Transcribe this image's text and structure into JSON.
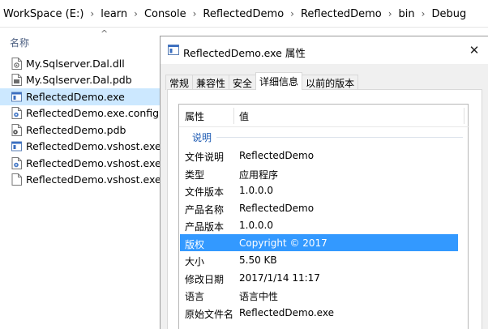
{
  "explorer": {
    "breadcrumbs": [
      "WorkSpace (E:)",
      "learn",
      "Console",
      "ReflectedDemo",
      "ReflectedDemo",
      "bin",
      "Debug"
    ],
    "column_name": "名称",
    "files": [
      {
        "name": "My.Sqlserver.Dal.dll",
        "icon": "dll-file-icon",
        "selected": false
      },
      {
        "name": "My.Sqlserver.Dal.pdb",
        "icon": "pdb-file-icon",
        "selected": false
      },
      {
        "name": "ReflectedDemo.exe",
        "icon": "exe-file-icon",
        "selected": true
      },
      {
        "name": "ReflectedDemo.exe.config",
        "icon": "config-file-icon",
        "selected": false
      },
      {
        "name": "ReflectedDemo.pdb",
        "icon": "pdb-file-icon",
        "selected": false
      },
      {
        "name": "ReflectedDemo.vshost.exe",
        "icon": "exe-file-icon",
        "selected": false
      },
      {
        "name": "ReflectedDemo.vshost.exe.cc",
        "icon": "config-file-icon",
        "selected": false
      },
      {
        "name": "ReflectedDemo.vshost.exe.m",
        "icon": "blank-file-icon",
        "selected": false
      }
    ]
  },
  "dialog": {
    "title": "ReflectedDemo.exe 属性",
    "close_symbol": "✕",
    "tabs": [
      {
        "label": "常规",
        "active": false
      },
      {
        "label": "兼容性",
        "active": false
      },
      {
        "label": "安全",
        "active": false
      },
      {
        "label": "详细信息",
        "active": true
      },
      {
        "label": "以前的版本",
        "active": false
      }
    ],
    "details": {
      "header_property": "属性",
      "header_value": "值",
      "group_label": "说明",
      "rows": [
        {
          "key": "文件说明",
          "value": "ReflectedDemo",
          "selected": false
        },
        {
          "key": "类型",
          "value": "应用程序",
          "selected": false
        },
        {
          "key": "文件版本",
          "value": "1.0.0.0",
          "selected": false
        },
        {
          "key": "产品名称",
          "value": "ReflectedDemo",
          "selected": false
        },
        {
          "key": "产品版本",
          "value": "1.0.0.0",
          "selected": false
        },
        {
          "key": "版权",
          "value": "Copyright ©  2017",
          "selected": true
        },
        {
          "key": "大小",
          "value": "5.50 KB",
          "selected": false
        },
        {
          "key": "修改日期",
          "value": "2017/1/14 11:17",
          "selected": false
        },
        {
          "key": "语言",
          "value": "语言中性",
          "selected": false
        },
        {
          "key": "原始文件名",
          "value": "ReflectedDemo.exe",
          "selected": false
        }
      ]
    }
  },
  "colors": {
    "selection_light": "#cce8ff",
    "selection_strong": "#3399ff",
    "group_label": "#1e5bb3"
  }
}
